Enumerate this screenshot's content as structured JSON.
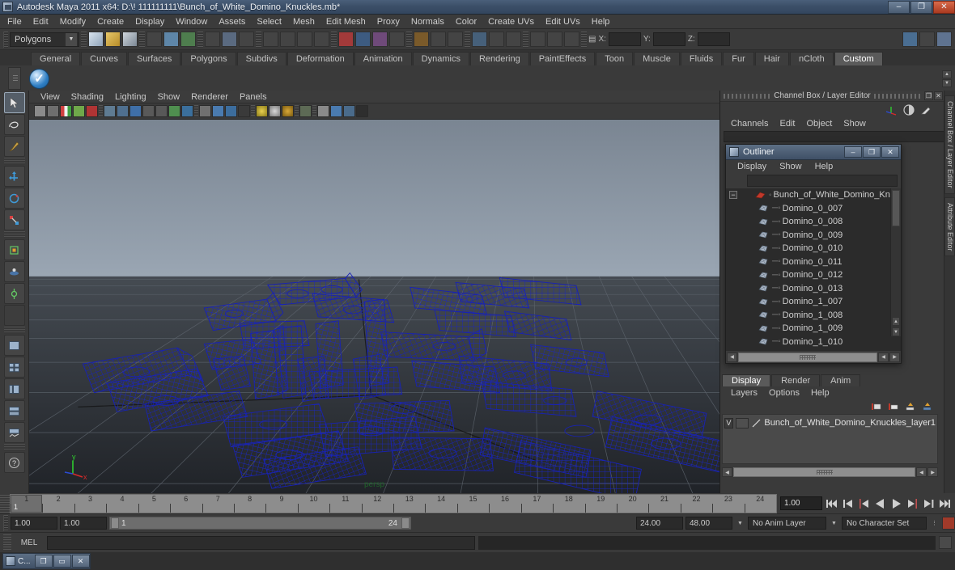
{
  "window": {
    "title": "Autodesk Maya 2011 x64: D:\\! 111111111\\Bunch_of_White_Domino_Knuckles.mb*",
    "minimize": "–",
    "maximize": "❐",
    "close": "✕",
    "app_icon": "maya-app-icon"
  },
  "menubar": {
    "items": [
      "File",
      "Edit",
      "Modify",
      "Create",
      "Display",
      "Window",
      "Assets",
      "Select",
      "Mesh",
      "Edit Mesh",
      "Proxy",
      "Normals",
      "Color",
      "Create UVs",
      "Edit UVs",
      "Help"
    ]
  },
  "statusline": {
    "mode_selector": "Polygons",
    "coord_labels": {
      "x": "X:",
      "y": "Y:",
      "z": "Z:"
    },
    "coord_values": {
      "x": "",
      "y": "",
      "z": ""
    }
  },
  "shelf": {
    "tabs": [
      "General",
      "Curves",
      "Surfaces",
      "Polygons",
      "Subdivs",
      "Deformation",
      "Animation",
      "Dynamics",
      "Rendering",
      "PaintEffects",
      "Toon",
      "Muscle",
      "Fluids",
      "Fur",
      "Hair",
      "nCloth",
      "Custom"
    ],
    "active_tab": "Custom"
  },
  "viewport": {
    "panel_menus": [
      "View",
      "Shading",
      "Lighting",
      "Show",
      "Renderer",
      "Panels"
    ],
    "camera_label": "persp",
    "axis": {
      "x": "x",
      "y": "y",
      "z": "z"
    },
    "colors": {
      "wireframe": "#1822b4",
      "sky_top": "#7f8a97",
      "ground": "#2f3236",
      "grid": "#5a6068",
      "axis_x": "#d42b2b",
      "axis_y": "#2fcc2f",
      "axis_z": "#2b4cd4"
    }
  },
  "channelbox": {
    "panel_title": "Channel Box / Layer Editor",
    "menus": [
      "Channels",
      "Edit",
      "Object",
      "Show"
    ],
    "restore_btn": "❐",
    "close_btn": "✕"
  },
  "vertical_tabs": [
    "Channel Box / Layer Editor",
    "Attribute Editor"
  ],
  "outliner": {
    "title": "Outliner",
    "icon": "outliner-window-icon",
    "minimize": "–",
    "maximize": "❐",
    "close": "✕",
    "menus": [
      "Display",
      "Show",
      "Help"
    ],
    "search_value": "",
    "root": "Bunch_of_White_Domino_Knuckles",
    "items": [
      "Domino_0_007",
      "Domino_0_008",
      "Domino_0_009",
      "Domino_0_010",
      "Domino_0_011",
      "Domino_0_012",
      "Domino_0_013",
      "Domino_1_007",
      "Domino_1_008",
      "Domino_1_009",
      "Domino_1_010"
    ],
    "expand_glyph": "−"
  },
  "layer_editor": {
    "tabs": [
      "Display",
      "Render",
      "Anim"
    ],
    "active_tab": "Display",
    "menus": [
      "Layers",
      "Options",
      "Help"
    ],
    "layer_name": "Bunch_of_White_Domino_Knuckles_layer1",
    "visibility_flag": "V"
  },
  "timeslider": {
    "current_frame": "1",
    "current_field": "1.00",
    "ticks": [
      "1",
      "2",
      "3",
      "4",
      "5",
      "6",
      "7",
      "8",
      "9",
      "10",
      "11",
      "12",
      "13",
      "14",
      "15",
      "16",
      "17",
      "18",
      "19",
      "20",
      "21",
      "22",
      "23",
      "24"
    ],
    "playback_buttons": [
      "go-to-start",
      "step-back-key",
      "step-back-frame",
      "play-backwards",
      "play-forwards",
      "step-forward-frame",
      "step-forward-key",
      "go-to-end"
    ]
  },
  "rangeslider": {
    "anim_start": "1.00",
    "range_start": "1.00",
    "bar_start": "1",
    "bar_end": "24",
    "range_end": "24.00",
    "anim_end": "48.00",
    "anim_layer": "No Anim Layer",
    "character_set": "No Character Set"
  },
  "commandline": {
    "language": "MEL",
    "input_value": ""
  },
  "taskbar": {
    "item_label": "C...",
    "minimize": "❐",
    "maximize": "▭",
    "close": "✕"
  }
}
